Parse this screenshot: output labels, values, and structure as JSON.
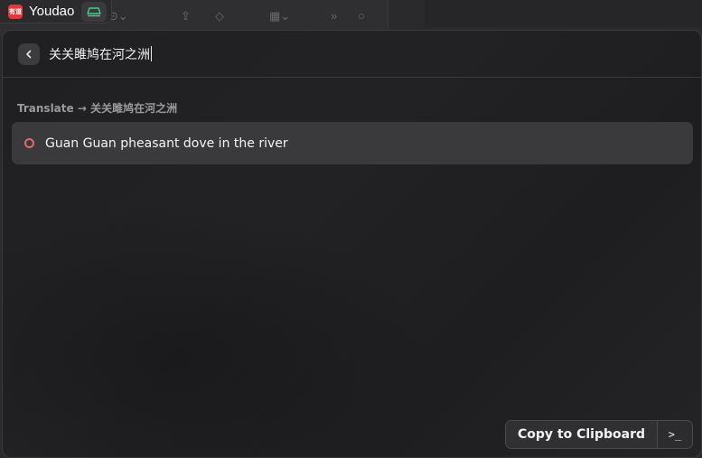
{
  "menubar": {
    "app_name": "Youdao",
    "logo_text": "有道",
    "app_icon": "youdao-logo",
    "extension_icon": "raycast-icon"
  },
  "search": {
    "query": "关关雎鸠在河之洲",
    "back_icon": "chevron-left-icon"
  },
  "section": {
    "title": "Translate → 关关雎鸠在河之洲"
  },
  "results": [
    {
      "text": "Guan Guan pheasant dove in the river",
      "icon": "circle-icon",
      "icon_color": "#e06a6e"
    }
  ],
  "actions": {
    "primary_label": "Copy to Clipboard",
    "secondary_label": ">_",
    "secondary_icon": "terminal-icon"
  },
  "colors": {
    "panel_bg": "#202022",
    "selected_row": "#3a3a3d",
    "logo_red": "#e2383a",
    "extension_green": "#3fcf8e"
  }
}
